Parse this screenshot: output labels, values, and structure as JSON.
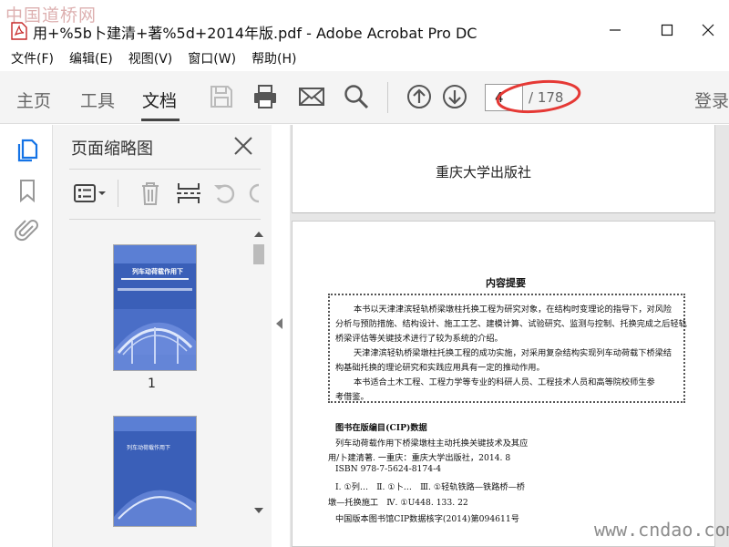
{
  "watermark_top": "中国道桥网",
  "watermark_bottom": "www.cndao.com",
  "window": {
    "title": "用+%5b卜建清+著%5d+2014年版.pdf - Adobe Acrobat Pro DC"
  },
  "menu": [
    "文件(F)",
    "编辑(E)",
    "视图(V)",
    "窗口(W)",
    "帮助(H)"
  ],
  "toolbar": {
    "tabs": [
      "主页",
      "工具",
      "文档"
    ],
    "active_tab": "文档",
    "page_current": "4",
    "page_total": "/ 178",
    "login": "登录"
  },
  "panel": {
    "title": "页面缩略图",
    "thumb_label_1": "1",
    "thumb_title": "列车动荷载作用下",
    "thumb_title2": "列车动荷载作用下"
  },
  "document": {
    "publisher": "重庆大学出版社",
    "abstract_title": "内容提要",
    "abstract_lines": [
      "本书以天津津滨轻轨桥梁墩柱托换工程为研究对象，在结构时变理论的指导下，对风险",
      "分析与预防措施、结构设计、施工工艺、建模计算、试验研究、监测与控制、托换完成之后轻轨",
      "桥梁评估等关键技术进行了较为系统的介绍。",
      "天津津滨轻轨桥梁墩柱托换工程的成功实施，对采用复杂结构实现列车动荷载下桥梁结",
      "构基础托换的理论研究和实践应用具有一定的推动作用。",
      "本书适合土木工程、工程力学等专业的科研人员、工程技术人员和高等院校师生参",
      "考借鉴。"
    ],
    "cip_lines": [
      "图书在版编目(CIP)数据",
      "列车动荷载作用下桥梁墩柱主动托换关键技术及其应",
      "用/卜建清著. 一重庆：重庆大学出版社，2014. 8",
      "ISBN 978-7-5624-8174-4",
      "Ⅰ. ①列…　Ⅱ. ①卜…　Ⅲ. ①轻轨铁路—铁路桥—桥",
      "墩—托换施工　Ⅳ. ①U448. 133. 22",
      "中国版本图书馆CIP数据核字(2014)第094611号"
    ]
  },
  "colors": {
    "accent_blue": "#1473e6",
    "annotation_red": "#e53935",
    "thumb_blue": "#3a5fb8"
  }
}
